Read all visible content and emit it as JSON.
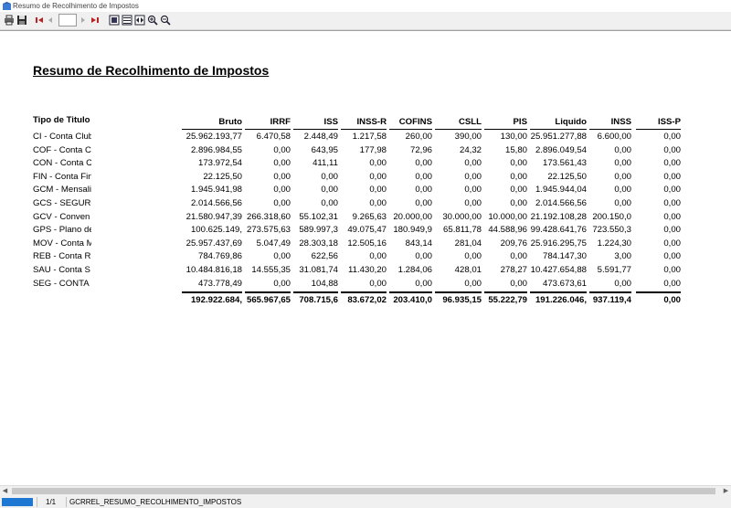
{
  "window": {
    "title": "Resumo de Recolhimento de Impostos"
  },
  "toolbar": {
    "page_value": "",
    "buttons": [
      "print-icon",
      "save-icon",
      "first-page-icon",
      "prev-page-icon",
      "next-page-icon",
      "last-page-icon",
      "page-view-icon",
      "fit-page-icon",
      "fit-width-icon",
      "zoom-in-icon",
      "zoom-out-icon"
    ]
  },
  "report": {
    "title": "Resumo de Recolhimento de Impostos",
    "columns": [
      "Tipo de Titulo",
      "Bruto",
      "IRRF",
      "ISS",
      "INSS-R",
      "COFINS",
      "CSLL",
      "PIS",
      "Liquido",
      "INSS",
      "ISS-P"
    ],
    "rows": [
      [
        "CI - Conta Club",
        "25.962.193,77",
        "6.470,58",
        "2.448,49",
        "1.217,58",
        "260,00",
        "390,00",
        "130,00",
        "25.951.277,88",
        "6.600,00",
        "0,00"
      ],
      [
        "COF - Conta Co",
        "2.896.984,55",
        "0,00",
        "643,95",
        "177,98",
        "72,96",
        "24,32",
        "15,80",
        "2.896.049,54",
        "0,00",
        "0,00"
      ],
      [
        "CON - Conta C",
        "173.972,54",
        "0,00",
        "411,11",
        "0,00",
        "0,00",
        "0,00",
        "0,00",
        "173.561,43",
        "0,00",
        "0,00"
      ],
      [
        "FIN - Conta Fin",
        "22.125,50",
        "0,00",
        "0,00",
        "0,00",
        "0,00",
        "0,00",
        "0,00",
        "22.125,50",
        "0,00",
        "0,00"
      ],
      [
        "GCM - Mensalic",
        "1.945.941,98",
        "0,00",
        "0,00",
        "0,00",
        "0,00",
        "0,00",
        "0,00",
        "1.945.944,04",
        "0,00",
        "0,00"
      ],
      [
        "GCS - SEGURC",
        "2.014.566,56",
        "0,00",
        "0,00",
        "0,00",
        "0,00",
        "0,00",
        "0,00",
        "2.014.566,56",
        "0,00",
        "0,00"
      ],
      [
        "GCV - Conven",
        "21.580.947,39",
        "266.318,60",
        "55.102,31",
        "9.265,63",
        "20.000,00",
        "30.000,00",
        "10.000,00",
        "21.192.108,28",
        "200.150,0",
        "0,00"
      ],
      [
        "GPS - Plano de",
        "100.625.149,",
        "273.575,63",
        "589.997,3",
        "49.075,47",
        "180.949,9",
        "65.811,78",
        "44.588,96",
        "99.428.641,76",
        "723.550,3",
        "0,00"
      ],
      [
        "MOV - Conta M",
        "25.957.437,69",
        "5.047,49",
        "28.303,18",
        "12.505,16",
        "843,14",
        "281,04",
        "209,76",
        "25.916.295,75",
        "1.224,30",
        "0,00"
      ],
      [
        "REB - Conta Re",
        "784.769,86",
        "0,00",
        "622,56",
        "0,00",
        "0,00",
        "0,00",
        "0,00",
        "784.147,30",
        "3,00",
        "0,00"
      ],
      [
        "SAU - Conta S",
        "10.484.816,18",
        "14.555,35",
        "31.081,74",
        "11.430,20",
        "1.284,06",
        "428,01",
        "278,27",
        "10.427.654,88",
        "5.591,77",
        "0,00"
      ],
      [
        "SEG - CONTA",
        "473.778,49",
        "0,00",
        "104,88",
        "0,00",
        "0,00",
        "0,00",
        "0,00",
        "473.673,61",
        "0,00",
        "0,00"
      ]
    ],
    "totals": [
      "192.922.684,",
      "565.967,65",
      "708.715,6",
      "83.672,02",
      "203.410,0",
      "96.935,15",
      "55.222,79",
      "191.226.046,",
      "937.119,4",
      "0,00"
    ]
  },
  "statusbar": {
    "pages": "1/1",
    "report_name": "GCRREL_RESUMO_RECOLHIMENTO_IMPOSTOS"
  }
}
